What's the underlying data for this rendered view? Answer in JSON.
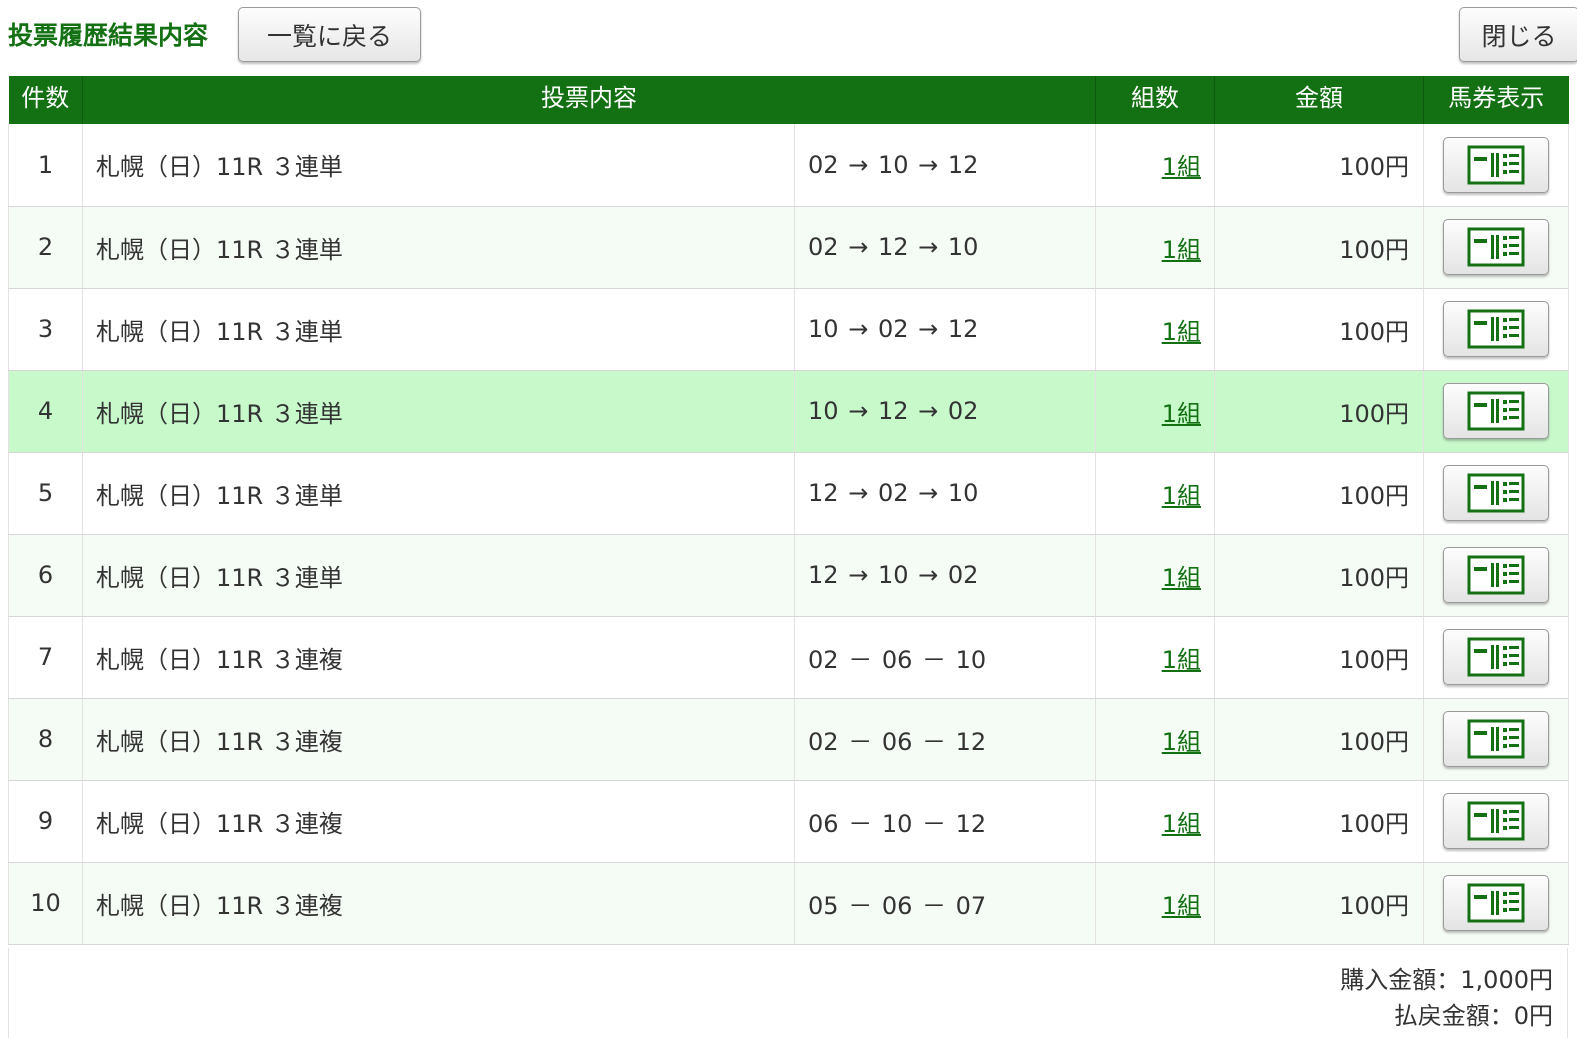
{
  "header": {
    "title": "投票履歴結果内容",
    "back_label": "一覧に戻る",
    "close_label": "閉じる"
  },
  "table": {
    "columns": [
      "件数",
      "投票内容",
      "組数",
      "金額",
      "馬券表示"
    ],
    "rows": [
      {
        "no": "1",
        "race": "札幌（日）11R ３連単",
        "combo": [
          "02",
          "10",
          "12"
        ],
        "sep": "→",
        "sets": "1組",
        "amount": "100円",
        "highlight": false
      },
      {
        "no": "2",
        "race": "札幌（日）11R ３連単",
        "combo": [
          "02",
          "12",
          "10"
        ],
        "sep": "→",
        "sets": "1組",
        "amount": "100円",
        "highlight": false
      },
      {
        "no": "3",
        "race": "札幌（日）11R ３連単",
        "combo": [
          "10",
          "02",
          "12"
        ],
        "sep": "→",
        "sets": "1組",
        "amount": "100円",
        "highlight": false
      },
      {
        "no": "4",
        "race": "札幌（日）11R ３連単",
        "combo": [
          "10",
          "12",
          "02"
        ],
        "sep": "→",
        "sets": "1組",
        "amount": "100円",
        "highlight": true
      },
      {
        "no": "5",
        "race": "札幌（日）11R ３連単",
        "combo": [
          "12",
          "02",
          "10"
        ],
        "sep": "→",
        "sets": "1組",
        "amount": "100円",
        "highlight": false
      },
      {
        "no": "6",
        "race": "札幌（日）11R ３連単",
        "combo": [
          "12",
          "10",
          "02"
        ],
        "sep": "→",
        "sets": "1組",
        "amount": "100円",
        "highlight": false
      },
      {
        "no": "7",
        "race": "札幌（日）11R ３連複",
        "combo": [
          "02",
          "06",
          "10"
        ],
        "sep": "－",
        "sets": "1組",
        "amount": "100円",
        "highlight": false
      },
      {
        "no": "8",
        "race": "札幌（日）11R ３連複",
        "combo": [
          "02",
          "06",
          "12"
        ],
        "sep": "－",
        "sets": "1組",
        "amount": "100円",
        "highlight": false
      },
      {
        "no": "9",
        "race": "札幌（日）11R ３連複",
        "combo": [
          "06",
          "10",
          "12"
        ],
        "sep": "－",
        "sets": "1組",
        "amount": "100円",
        "highlight": false
      },
      {
        "no": "10",
        "race": "札幌（日）11R ３連複",
        "combo": [
          "05",
          "06",
          "07"
        ],
        "sep": "－",
        "sets": "1組",
        "amount": "100円",
        "highlight": false
      }
    ],
    "ticket_icon": "ticket-display-icon"
  },
  "summary": {
    "purchase": "購入金額：1,000円",
    "refund": "払戻金額：0円"
  },
  "colors": {
    "brand_green": "#137013",
    "row_highlight": "#c8f9cb",
    "row_alt": "#f5fbf5"
  }
}
